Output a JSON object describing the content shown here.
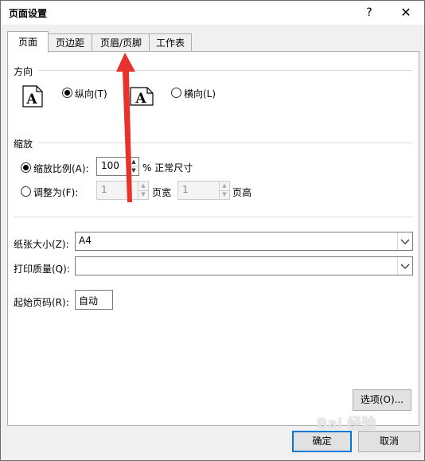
{
  "window": {
    "title": "页面设置",
    "help_label": "?",
    "close_label": "✕"
  },
  "tabs": [
    {
      "label": "页面",
      "active": true
    },
    {
      "label": "页边距",
      "active": false
    },
    {
      "label": "页眉/页脚",
      "active": false
    },
    {
      "label": "工作表",
      "active": false
    }
  ],
  "orientation": {
    "section_label": "方向",
    "portrait_label": "纵向(T)",
    "landscape_label": "横向(L)",
    "selected": "portrait",
    "icon_glyph": "A"
  },
  "scaling": {
    "section_label": "缩放",
    "adjust_label": "缩放比例(A):",
    "adjust_value": "100",
    "adjust_suffix": "% 正常尺寸",
    "fit_label": "调整为(F):",
    "fit_wide_value": "1",
    "fit_wide_label": "页宽",
    "fit_tall_value": "1",
    "fit_tall_label": "页高",
    "selected": "adjust"
  },
  "paper_size": {
    "label": "纸张大小(Z):",
    "value": "A4"
  },
  "print_quality": {
    "label": "打印质量(Q):",
    "value": ""
  },
  "first_page": {
    "label": "起始页码(R):",
    "value": "自动"
  },
  "buttons": {
    "options": "选项(O)...",
    "ok": "确定",
    "cancel": "取消"
  },
  "annotation": {
    "arrow_color": "#e8322c"
  },
  "watermark": {
    "text": "Bai 经验"
  }
}
